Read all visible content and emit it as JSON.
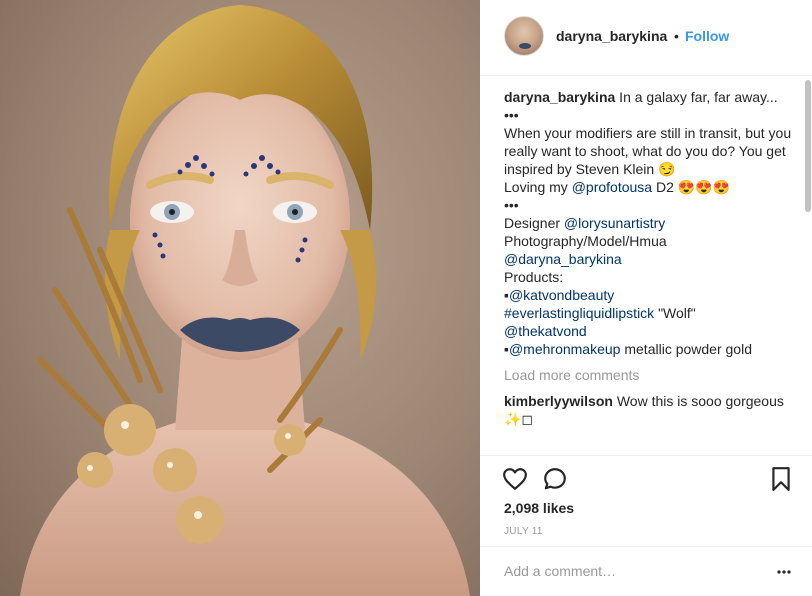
{
  "post": {
    "username": "daryna_barykina",
    "dot": "•",
    "follow_label": "Follow"
  },
  "caption": {
    "username": "daryna_barykina",
    "line1": " In a galaxy far, far away...",
    "dots1": "•••",
    "line2": "When your modifiers are still in transit, but you really want to shoot, what do you do? You get inspired by Steven Klein 😏",
    "line3_pre": "Loving my ",
    "line3_mention": "@profotousa",
    "line3_post": " D2 😍😍😍",
    "dots2": "•••",
    "designer_label": "Designer ",
    "designer_mention": "@lorysunartistry",
    "photo_label": "Photography/Model/Hmua",
    "photo_mention": "@daryna_barykina",
    "products_label": "Products:",
    "bullet1": "▪",
    "product1": "@katvondbeauty",
    "product2_tag": "#everlastingliquidlipstick",
    "product2_post": " \"Wolf\"",
    "product3": "@thekatvond",
    "bullet2": "▪",
    "product4": "@mehronmakeup",
    "product4_post": " metallic powder gold"
  },
  "load_more": "Load more comments",
  "comment": {
    "username": "kimberlyywilson",
    "text": " Wow this is sooo gorgeous ✨◻"
  },
  "icons": {
    "like": "heart-icon",
    "comment": "comment-bubble-icon",
    "save": "bookmark-icon",
    "more": "more-options-icon"
  },
  "likes": "2,098 likes",
  "date": "JULY 11",
  "add_comment_placeholder": "Add a comment…"
}
